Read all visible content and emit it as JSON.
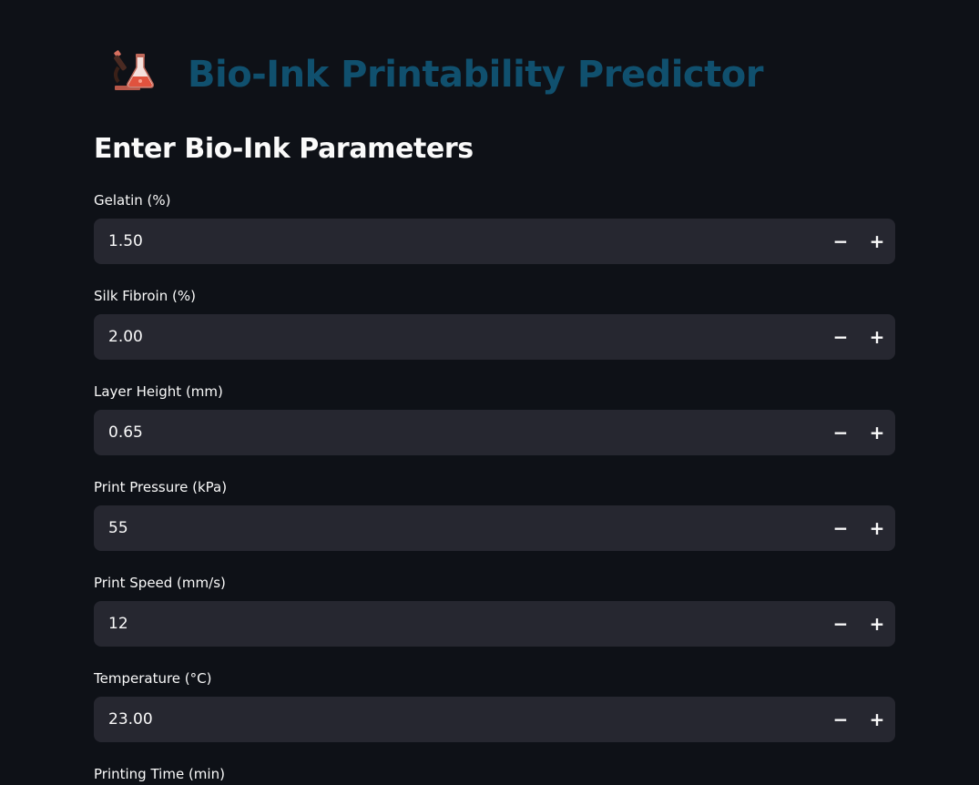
{
  "header": {
    "title": "Bio-Ink Printability Predictor",
    "logo_icon": "microscope-and-flask-icon"
  },
  "section": {
    "title": "Enter Bio-Ink Parameters"
  },
  "stepper": {
    "minus": "−",
    "plus": "+"
  },
  "fields": [
    {
      "label": "Gelatin (%)",
      "value": "1.50"
    },
    {
      "label": "Silk Fibroin (%)",
      "value": "2.00"
    },
    {
      "label": "Layer Height (mm)",
      "value": "0.65"
    },
    {
      "label": "Print Pressure (kPa)",
      "value": "55"
    },
    {
      "label": "Print Speed (mm/s)",
      "value": "12"
    },
    {
      "label": "Temperature (°C)",
      "value": "23.00"
    },
    {
      "label": "Printing Time (min)",
      "value": ""
    }
  ],
  "colors": {
    "background": "#0e1117",
    "title": "#10506e",
    "input_background": "#262730",
    "text": "#fafafa"
  }
}
